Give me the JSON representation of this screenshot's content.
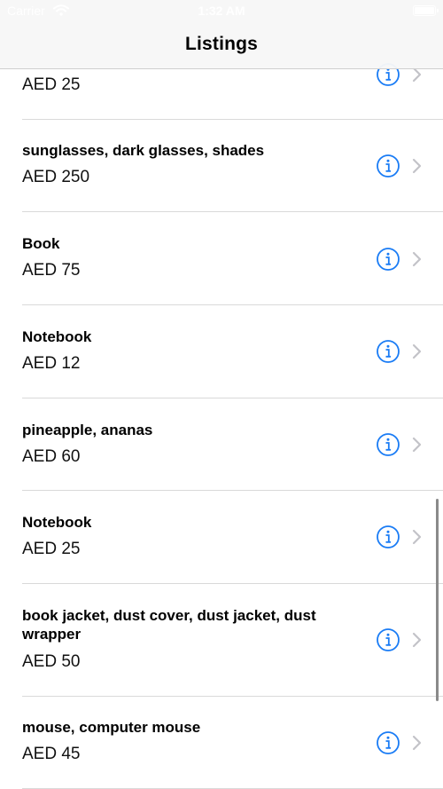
{
  "status_bar": {
    "carrier": "Carrier",
    "time": "1:32 AM"
  },
  "nav": {
    "title": "Listings"
  },
  "colors": {
    "accent": "#1a7cf5",
    "chevron": "#c3c3c8",
    "separator": "#d9d9d9"
  },
  "listings": [
    {
      "title": "",
      "price": "AED 25"
    },
    {
      "title": "sunglasses, dark glasses, shades",
      "price": "AED 250"
    },
    {
      "title": "Book",
      "price": "AED 75"
    },
    {
      "title": "Notebook",
      "price": "AED 12"
    },
    {
      "title": "pineapple, ananas",
      "price": "AED 60"
    },
    {
      "title": "Notebook",
      "price": "AED 25"
    },
    {
      "title": "book jacket, dust cover, dust jacket, dust wrapper",
      "price": "AED 50"
    },
    {
      "title": "mouse, computer mouse",
      "price": "AED 45"
    }
  ],
  "icons": {
    "info": "info-circle-icon",
    "chevron": "chevron-right-icon",
    "wifi": "wifi-icon",
    "battery": "battery-icon"
  }
}
